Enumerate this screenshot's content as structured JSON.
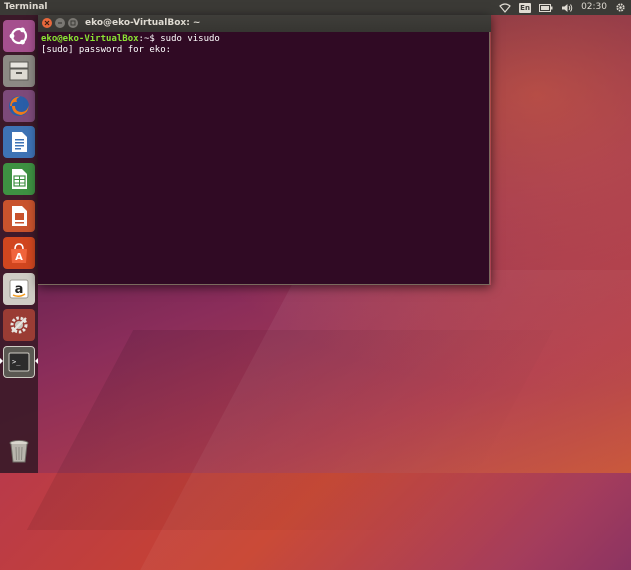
{
  "top_panel": {
    "app_title": "Terminal",
    "keyboard_layout": "En",
    "clock": "02:30"
  },
  "launcher": {
    "items": [
      {
        "name": "dash-home",
        "icon": "ubuntu-logo-icon"
      },
      {
        "name": "files",
        "icon": "file-cabinet-icon"
      },
      {
        "name": "firefox",
        "icon": "firefox-icon"
      },
      {
        "name": "libreoffice-writer",
        "icon": "writer-icon"
      },
      {
        "name": "libreoffice-calc",
        "icon": "calc-icon"
      },
      {
        "name": "libreoffice-impress",
        "icon": "impress-icon"
      },
      {
        "name": "ubuntu-software",
        "icon": "software-bag-icon",
        "glyph": "A"
      },
      {
        "name": "amazon",
        "icon": "amazon-icon",
        "glyph": "a"
      },
      {
        "name": "system-settings",
        "icon": "settings-icon"
      },
      {
        "name": "terminal",
        "icon": "terminal-icon",
        "glyph": ">_"
      },
      {
        "name": "trash",
        "icon": "trash-icon"
      }
    ]
  },
  "terminal": {
    "window_title": "eko@eko-VirtualBox: ~",
    "prompt_user": "eko@eko-VirtualBox",
    "prompt_path": ":~",
    "prompt_symbol": "$ ",
    "command": "sudo visudo",
    "output_line": "[sudo] password for eko:"
  },
  "colors": {
    "panel_bg": "#3b3a36",
    "terminal_bg": "#300a24",
    "prompt_user": "#8ae234",
    "prompt_path": "#729fcf",
    "close_button": "#e8683c"
  }
}
